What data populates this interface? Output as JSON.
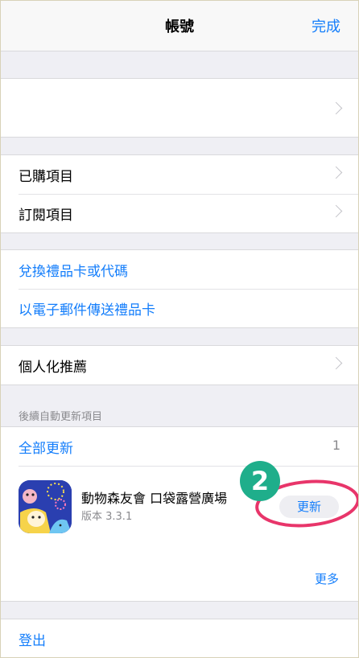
{
  "navbar": {
    "title": "帳號",
    "done_label": "完成"
  },
  "purchases": {
    "purchased_label": "已購項目",
    "subscriptions_label": "訂閱項目"
  },
  "gift": {
    "redeem_label": "兌換禮品卡或代碼",
    "send_label": "以電子郵件傳送禮品卡"
  },
  "personal": {
    "recommendations_label": "個人化推薦"
  },
  "updates": {
    "header": "後續自動更新項目",
    "update_all_label": "全部更新",
    "pending_count": "1",
    "app": {
      "name": "動物森友會 口袋露營廣場",
      "version": "版本 3.3.1",
      "update_label": "更新"
    },
    "more_label": "更多"
  },
  "annotation": {
    "step_number": "2"
  },
  "signout": {
    "label": "登出"
  },
  "colors": {
    "accent": "#147efb",
    "annotation_green": "#1fae8b",
    "annotation_pink": "#e8356a"
  }
}
